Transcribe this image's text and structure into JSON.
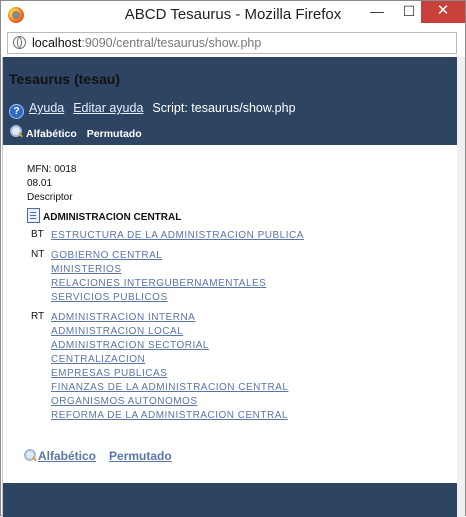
{
  "window": {
    "title": "ABCD Tesaurus - Mozilla Firefox",
    "min": "—",
    "max": "☐",
    "close": "✕"
  },
  "urlbar": {
    "host": "localhost",
    "rest": ":9090/central/tesaurus/show.php"
  },
  "header": {
    "title": "Tesaurus (tesau)",
    "help_link": "Ayuda",
    "edit_help_link": "Editar ayuda",
    "script_text": "Script: tesaurus/show.php",
    "nav": {
      "alpha": "Alfabético",
      "permuted": "Permutado"
    }
  },
  "record": {
    "mfn": "MFN: 0018",
    "code": "08.01",
    "type": "Descriptor",
    "term": "ADMINISTRACION CENTRAL"
  },
  "relations": [
    {
      "code": "BT",
      "terms": [
        "ESTRUCTURA DE LA ADMINISTRACION PUBLICA"
      ]
    },
    {
      "code": "NT",
      "terms": [
        "GOBIERNO CENTRAL",
        "MINISTERIOS",
        "RELACIONES INTERGUBERNAMENTALES",
        "SERVICIOS PUBLICOS"
      ]
    },
    {
      "code": "RT",
      "terms": [
        "ADMINISTRACION INTERNA",
        "ADMINISTRACION LOCAL",
        "ADMINISTRACION SECTORIAL",
        "CENTRALIZACION",
        "EMPRESAS PUBLICAS",
        "FINANZAS DE LA ADMINISTRACION CENTRAL",
        "ORGANISMOS AUTONOMOS",
        "REFORMA DE LA ADMINISTRACION CENTRAL"
      ]
    }
  ],
  "footer": {
    "alpha": "Alfabético",
    "permuted": "Permutado"
  },
  "colors": {
    "band": "#2e4463",
    "link": "#5a76a8",
    "close": "#c7413a"
  }
}
